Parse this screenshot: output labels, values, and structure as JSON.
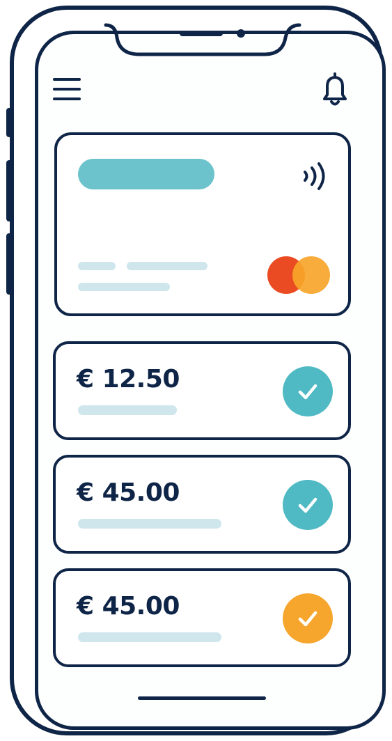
{
  "header": {
    "menu_icon": "hamburger-menu-icon",
    "notification_icon": "bell-icon"
  },
  "card": {
    "contactless_icon": "contactless-icon",
    "brand_icon": "card-brand-logo-icon",
    "colors": {
      "name_bar": "#6cc3cb",
      "brand_red": "#ea4b22",
      "brand_yellow": "#f7a52a"
    }
  },
  "transactions": [
    {
      "amount": "€ 12.50",
      "status_icon": "check-icon",
      "status_color": "#4fb9c4"
    },
    {
      "amount": "€ 45.00",
      "status_icon": "check-icon",
      "status_color": "#4fb9c4"
    },
    {
      "amount": "€ 45.00",
      "status_icon": "check-icon",
      "status_color": "#f6a62d"
    }
  ],
  "colors": {
    "outline": "#0f2547",
    "placeholder_line": "#cfe6ec",
    "teal_status": "#4fb9c4",
    "orange_status": "#f6a62d"
  }
}
